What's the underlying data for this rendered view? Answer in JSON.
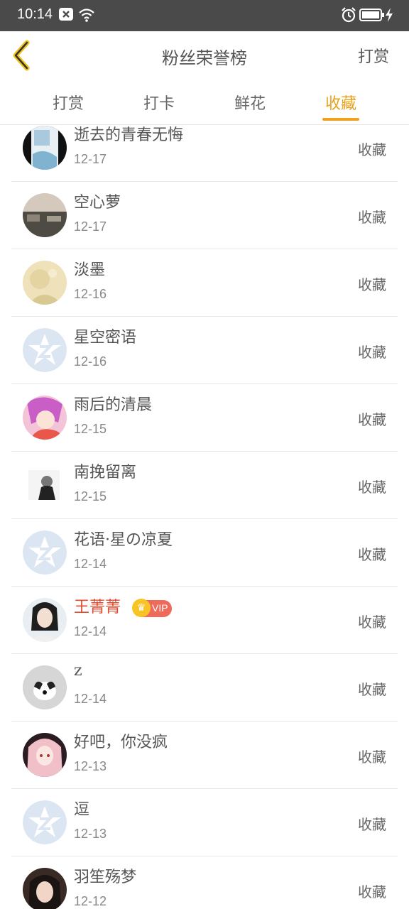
{
  "status_bar": {
    "time": "10:14"
  },
  "header": {
    "title": "粉丝荣誉榜",
    "action_label": "打赏"
  },
  "tabs": [
    {
      "label": "打赏"
    },
    {
      "label": "打卡"
    },
    {
      "label": "鲜花"
    },
    {
      "label": "收藏"
    }
  ],
  "active_tab": "收藏",
  "colors": {
    "accent": "#f0a21e",
    "vip_name": "#e04a2f",
    "default_avatar": "#dce6f3"
  },
  "list": [
    {
      "name": "逝去的青春无悔",
      "date": "12-17",
      "action": "收藏",
      "avatar": "book-cover-avatar"
    },
    {
      "name": "空心萝",
      "date": "12-17",
      "action": "收藏",
      "avatar": "photo-avatar"
    },
    {
      "name": "淡墨",
      "date": "12-16",
      "action": "收藏",
      "avatar": "photo-avatar"
    },
    {
      "name": "星空密语",
      "date": "12-16",
      "action": "收藏",
      "avatar": "default-z-avatar"
    },
    {
      "name": "雨后的清晨",
      "date": "12-15",
      "action": "收藏",
      "avatar": "anime-avatar"
    },
    {
      "name": "南挽留离",
      "date": "12-15",
      "action": "收藏",
      "avatar": "photo-avatar"
    },
    {
      "name": "花语·星の凉夏",
      "date": "12-14",
      "action": "收藏",
      "avatar": "default-z-avatar"
    },
    {
      "name": "王菁菁",
      "date": "12-14",
      "action": "收藏",
      "avatar": "photo-avatar",
      "vip_badge": "VIP"
    },
    {
      "name": "z",
      "date": "12-14",
      "action": "收藏",
      "avatar": "dog-avatar"
    },
    {
      "name": "好吧，你没疯",
      "date": "12-13",
      "action": "收藏",
      "avatar": "anime-avatar"
    },
    {
      "name": "逗",
      "date": "12-13",
      "action": "收藏",
      "avatar": "default-z-avatar"
    },
    {
      "name": "羽笙殇梦",
      "date": "12-12",
      "action": "收藏",
      "avatar": "photo-avatar"
    }
  ]
}
